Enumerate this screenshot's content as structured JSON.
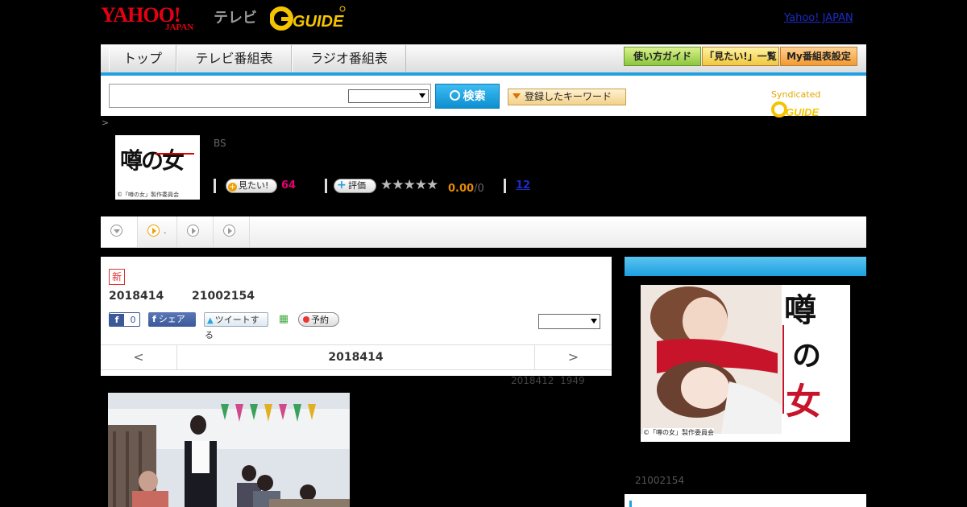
{
  "header": {
    "yahoo_logo": "YAHOO!",
    "yahoo_japan": "JAPAN",
    "tv_label": "テレビ",
    "gguide_logo": "G-GUIDE",
    "yahoo_japan_link": "Yahoo! JAPAN"
  },
  "nav": {
    "tabs": [
      "トップ",
      "テレビ番組表",
      "ラジオ番組表"
    ],
    "right_buttons": [
      "使い方ガイド",
      "「見たい!」一覧",
      "My番組表設定"
    ]
  },
  "search": {
    "button_label": "検索",
    "keyword_button": "登録したキーワード",
    "syndicated": "Syndicated"
  },
  "breadcrumb_arrow": ">",
  "program": {
    "thumb_title": "噂の女",
    "thumb_copyright": "©「噂の女」製作委員会",
    "channel_type": "BS",
    "mitai_label": "見たい!",
    "mitai_count": "64",
    "rating_label": "評価",
    "rating_score": "0.00",
    "rating_total": "/0",
    "review_count": "12"
  },
  "subtabs": {
    "tab2_text": "."
  },
  "episode": {
    "new_badge": "新",
    "date": "2018414",
    "time": "21002154",
    "like_count": "0",
    "share_label": "シェア",
    "tweet_label": "ツイートする",
    "reserve_label": "予約",
    "pager_prev": "<",
    "pager_date": "2018414",
    "pager_next": ">",
    "updated_date": "2018412",
    "updated_time": "1949"
  },
  "side": {
    "poster_title": "噂の女",
    "poster_copyright": "©「噂の女」製作委員会",
    "time": "21002154"
  },
  "colors": {
    "accent_blue": "#1fa0e0",
    "pink": "#e6006f",
    "orange": "#e68a00",
    "link": "#1b2cc7"
  }
}
